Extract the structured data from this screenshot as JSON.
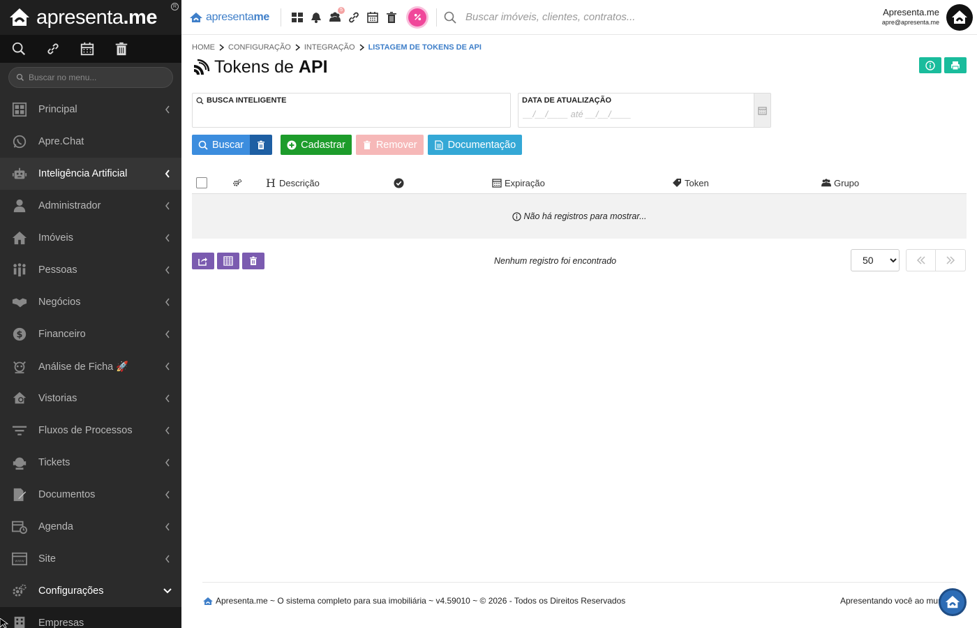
{
  "brand": {
    "name_light": "apresenta",
    "name_bold": ".me",
    "reg": "R",
    "top_light": "apresenta",
    "top_bold": "me"
  },
  "sidebar": {
    "search_placeholder": "Buscar no menu...",
    "items": [
      {
        "label": "Principal",
        "icon": "grid-icon"
      },
      {
        "label": "Apre.Chat",
        "icon": "whatsapp-icon"
      },
      {
        "label": "Inteligência Artificial",
        "icon": "robot-icon"
      },
      {
        "label": "Administrador",
        "icon": "user-tie-icon"
      },
      {
        "label": "Imóveis",
        "icon": "home-icon"
      },
      {
        "label": "Pessoas",
        "icon": "people-icon"
      },
      {
        "label": "Negócios",
        "icon": "handshake-icon"
      },
      {
        "label": "Financeiro",
        "icon": "dollar-icon"
      },
      {
        "label": "Análise de Ficha 🚀",
        "icon": "detective-icon"
      },
      {
        "label": "Vistorias",
        "icon": "inspection-icon"
      },
      {
        "label": "Fluxos de Processos",
        "icon": "filter-icon"
      },
      {
        "label": "Tickets",
        "icon": "support-icon"
      },
      {
        "label": "Documentos",
        "icon": "document-edit-icon"
      },
      {
        "label": "Agenda",
        "icon": "calendar-clock-icon"
      },
      {
        "label": "Site",
        "icon": "www-icon"
      },
      {
        "label": "Configurações",
        "icon": "cogs-icon"
      },
      {
        "label": "Empresas",
        "icon": "building-icon"
      }
    ]
  },
  "topbar": {
    "search_placeholder": "Buscar imóveis, clientes, contratos...",
    "notification_badge": "5",
    "user_name": "Apresenta.me",
    "user_email": "apre@apresenta.me"
  },
  "breadcrumb": {
    "items": [
      "HOME",
      "CONFIGURAÇÃO",
      "INTEGRAÇÃO"
    ],
    "current": "LISTAGEM DE TOKENS DE API"
  },
  "page": {
    "title_prefix": "Tokens de ",
    "title_bold": "API"
  },
  "filters": {
    "smart_label": "BUSCA INTELIGENTE",
    "smart_value": "",
    "date_label": "DATA DE ATUALIZAÇÃO",
    "date_placeholder": "__/__/____ até __/__/____"
  },
  "buttons": {
    "search": "Buscar",
    "add": "Cadastrar",
    "remove": "Remover",
    "docs": "Documentação"
  },
  "table": {
    "columns": {
      "description": "Descrição",
      "expiration": "Expiração",
      "token": "Token",
      "group": "Grupo"
    },
    "empty_message": "Não há registros para mostrar..."
  },
  "pagination": {
    "no_records": "Nenhum registro foi encontrado",
    "page_size": "50",
    "page_size_options": [
      "50"
    ]
  },
  "footer": {
    "text": "Apresenta.me ~ O sistema completo para sua imobiliária ~ v4.59010 ~ © 2026 - Todos os Direitos Reservados",
    "right": "Apresentando você ao mundo"
  },
  "colors": {
    "sidebar_bg": "#2b2b2b",
    "accent_blue": "#3c8dde",
    "success": "#1d9c2b",
    "teal": "#1abc9c",
    "purple": "#7b5bb0",
    "pink": "#f0479a"
  }
}
